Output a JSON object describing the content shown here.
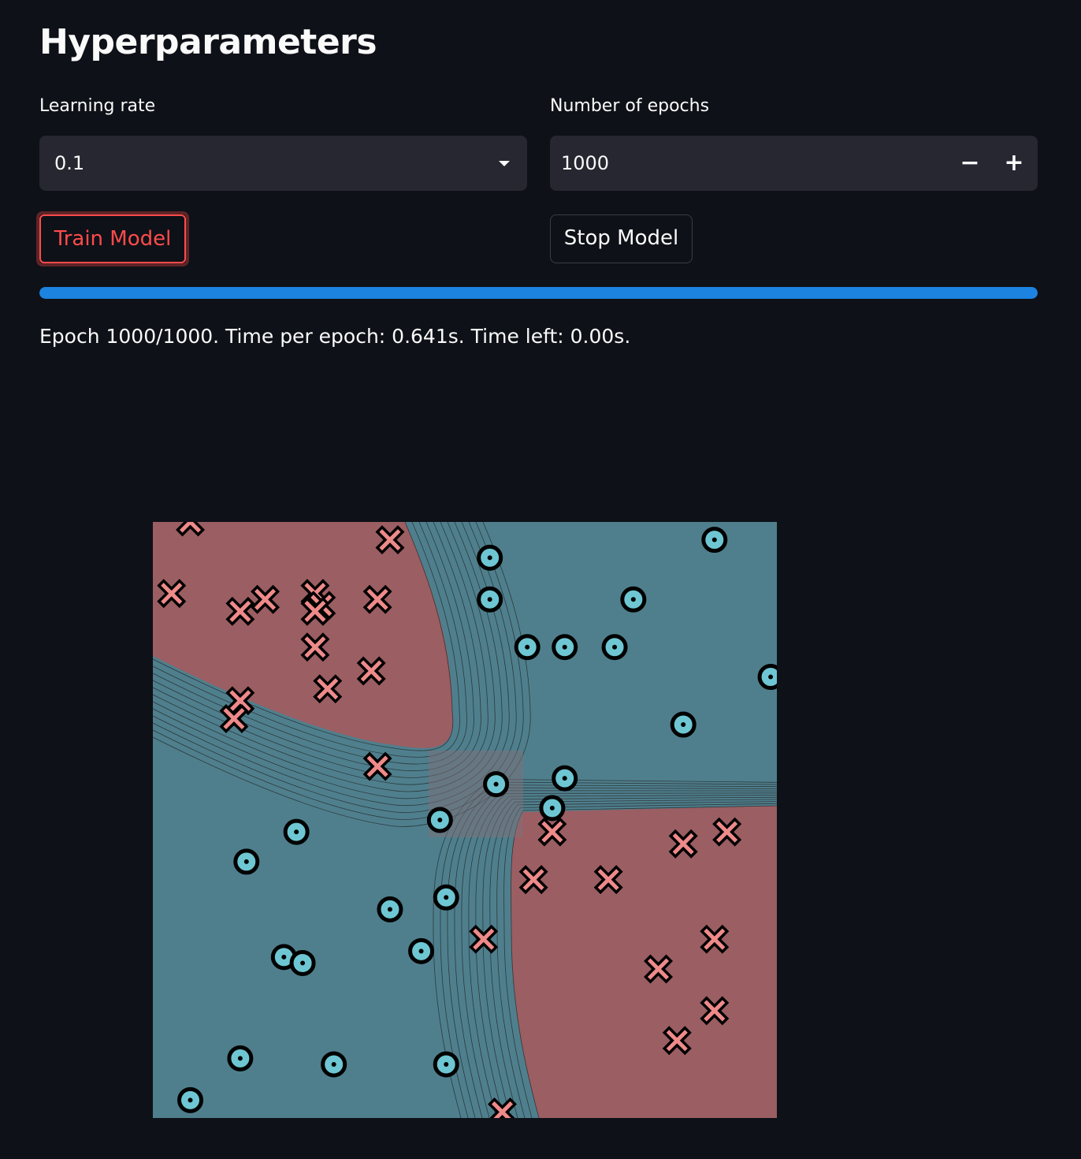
{
  "header": {
    "title": "Hyperparameters"
  },
  "learning_rate": {
    "label": "Learning rate",
    "selected": "0.1"
  },
  "epochs": {
    "label": "Number of epochs",
    "value": "1000",
    "minus": "−",
    "plus": "+"
  },
  "buttons": {
    "train": "Train Model",
    "stop": "Stop Model"
  },
  "progress": {
    "fraction": 1.0,
    "color": "#1c83e1"
  },
  "status": "Epoch 1000/1000. Time per epoch: 0.641s. Time left: 0.00s.",
  "colors": {
    "background": "#0e1117",
    "class_red_region": "#9b5e62",
    "class_blue_region": "#4f7f8d",
    "marker_red": "#ef8a8a",
    "marker_blue": "#6ec6d3",
    "accent_red": "#ff4b4b"
  },
  "chart_data": {
    "type": "scatter",
    "title": "",
    "xlabel": "",
    "ylabel": "",
    "xlim": [
      0,
      1
    ],
    "ylim": [
      0,
      1
    ],
    "grid": false,
    "legend": "none",
    "series": [
      {
        "marker": "x",
        "points": [
          [
            0.06,
            1.0
          ],
          [
            0.38,
            0.97
          ],
          [
            0.03,
            0.88
          ],
          [
            0.14,
            0.85
          ],
          [
            0.18,
            0.87
          ],
          [
            0.26,
            0.88
          ],
          [
            0.27,
            0.86
          ],
          [
            0.26,
            0.85
          ],
          [
            0.36,
            0.87
          ],
          [
            0.26,
            0.79
          ],
          [
            0.35,
            0.75
          ],
          [
            0.28,
            0.72
          ],
          [
            0.14,
            0.7
          ],
          [
            0.13,
            0.67
          ],
          [
            0.36,
            0.59
          ],
          [
            0.64,
            0.48
          ],
          [
            0.85,
            0.46
          ],
          [
            0.92,
            0.48
          ],
          [
            0.61,
            0.4
          ],
          [
            0.73,
            0.4
          ],
          [
            0.53,
            0.3
          ],
          [
            0.9,
            0.3
          ],
          [
            0.81,
            0.25
          ],
          [
            0.9,
            0.18
          ],
          [
            0.84,
            0.13
          ],
          [
            0.56,
            0.01
          ]
        ]
      },
      {
        "marker": "o",
        "points": [
          [
            0.54,
            0.94
          ],
          [
            0.9,
            0.97
          ],
          [
            0.54,
            0.87
          ],
          [
            0.77,
            0.87
          ],
          [
            0.6,
            0.79
          ],
          [
            0.66,
            0.79
          ],
          [
            0.74,
            0.79
          ],
          [
            0.99,
            0.74
          ],
          [
            0.85,
            0.66
          ],
          [
            0.55,
            0.56
          ],
          [
            0.66,
            0.57
          ],
          [
            0.64,
            0.52
          ],
          [
            0.23,
            0.48
          ],
          [
            0.46,
            0.5
          ],
          [
            0.15,
            0.43
          ],
          [
            0.38,
            0.35
          ],
          [
            0.47,
            0.37
          ],
          [
            0.43,
            0.28
          ],
          [
            0.21,
            0.27
          ],
          [
            0.24,
            0.26
          ],
          [
            0.14,
            0.1
          ],
          [
            0.29,
            0.09
          ],
          [
            0.47,
            0.09
          ],
          [
            0.06,
            0.03
          ]
        ]
      }
    ]
  }
}
